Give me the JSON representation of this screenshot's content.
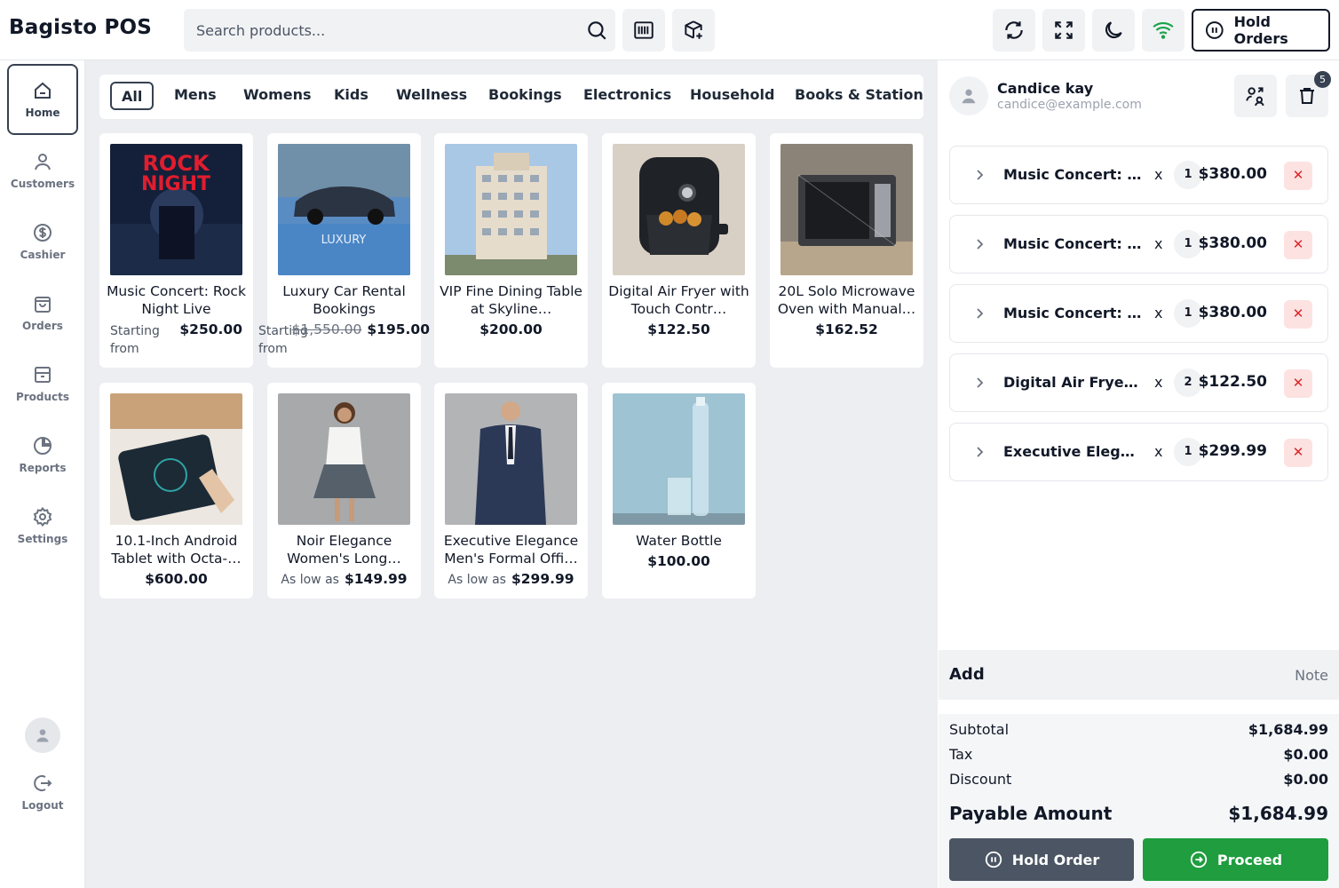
{
  "header": {
    "brand": "Bagisto POS",
    "search_placeholder": "Search products...",
    "hold_orders_label": "Hold Orders"
  },
  "sidebar": {
    "items": [
      {
        "label": "Home",
        "icon": "home-icon"
      },
      {
        "label": "Customers",
        "icon": "user-icon"
      },
      {
        "label": "Cashier",
        "icon": "dollar-icon"
      },
      {
        "label": "Orders",
        "icon": "bag-icon"
      },
      {
        "label": "Products",
        "icon": "box-icon"
      },
      {
        "label": "Reports",
        "icon": "pie-icon"
      },
      {
        "label": "Settings",
        "icon": "gear-icon"
      }
    ],
    "logout_label": "Logout"
  },
  "categories": [
    "All",
    "Mens",
    "Womens",
    "Kids",
    "Wellness",
    "Bookings",
    "Electronics",
    "Household",
    "Books & Stationery"
  ],
  "products": [
    {
      "name": "Music Concert: Rock Night Live",
      "label": "Starting from",
      "price": "$250.00"
    },
    {
      "name": "Luxury Car Rental Bookings",
      "label": "Starting from",
      "old_price": "$1,550.00",
      "price": "$195.00"
    },
    {
      "name": "VIP Fine Dining Table at Skyline…",
      "price": "$200.00"
    },
    {
      "name": "Digital Air Fryer with Touch Contr…",
      "price": "$122.50"
    },
    {
      "name": "20L Solo Microwave Oven with Manual…",
      "price": "$162.52"
    },
    {
      "name": "10.1-Inch Android Tablet with Octa-…",
      "price": "$600.00"
    },
    {
      "name": "Noir Elegance Women's Long…",
      "label": "As low as",
      "price": "$149.99"
    },
    {
      "name": "Executive Elegance Men's Formal Offi…",
      "label": "As low as",
      "price": "$299.99"
    },
    {
      "name": "Water Bottle",
      "price": "$100.00"
    }
  ],
  "customer": {
    "name": "Candice kay",
    "email": "candice@example.com",
    "cart_count": "5"
  },
  "cart": [
    {
      "name": "Music Concert: Rock Night Live",
      "x": "x",
      "qty": "1",
      "price": "$380.00"
    },
    {
      "name": "Music Concert: Rock Night Live",
      "x": "x",
      "qty": "1",
      "price": "$380.00"
    },
    {
      "name": "Music Concert: Rock Night Live",
      "x": "x",
      "qty": "1",
      "price": "$380.00"
    },
    {
      "name": "Digital Air Fryer with Touch Control",
      "x": "x",
      "qty": "2",
      "price": "$122.50"
    },
    {
      "name": "Executive Elegance Men's Formal Office",
      "x": "x",
      "qty": "1",
      "price": "$299.99"
    }
  ],
  "add_label": "Add",
  "note_label": "Note",
  "totals": {
    "subtotal_label": "Subtotal",
    "subtotal": "$1,684.99",
    "tax_label": "Tax",
    "tax": "$0.00",
    "discount_label": "Discount",
    "discount": "$0.00",
    "payable_label": "Payable Amount",
    "payable": "$1,684.99"
  },
  "actions": {
    "hold_order": "Hold Order",
    "proceed": "Proceed"
  },
  "colors": {
    "proceed": "#1f9d3f",
    "hold": "#4b5563",
    "wifi": "#16a34a",
    "remove": "#dc2626"
  }
}
